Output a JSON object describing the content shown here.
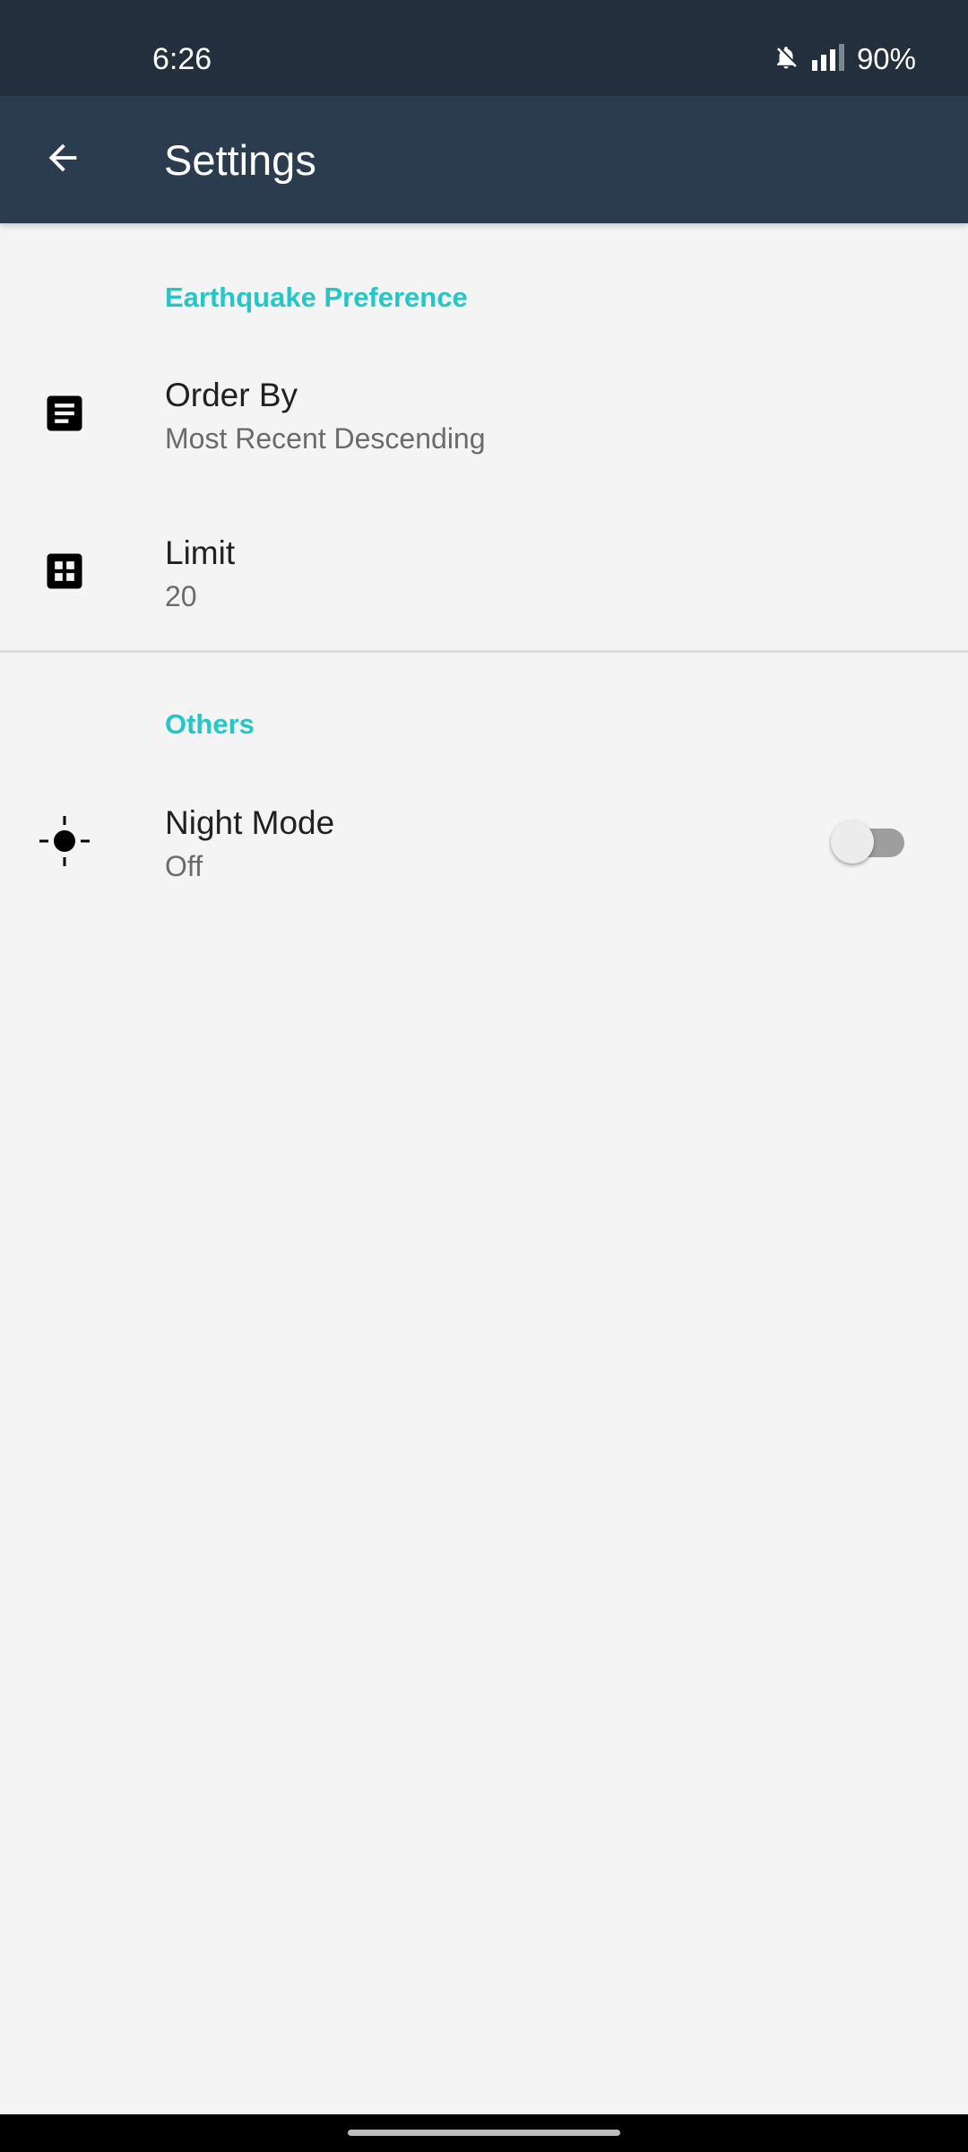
{
  "status_bar": {
    "time": "6:26",
    "battery": "90%",
    "icons": [
      "bell-off-icon",
      "signal-icon"
    ]
  },
  "toolbar": {
    "title": "Settings",
    "back_icon": "arrow-back-icon"
  },
  "sections": [
    {
      "category": "Earthquake Preference",
      "items": [
        {
          "title": "Order By",
          "summary": "Most Recent Descending",
          "icon": "notes-icon"
        },
        {
          "title": "Limit",
          "summary": "20",
          "icon": "grid-icon"
        }
      ]
    },
    {
      "category": "Others",
      "items": [
        {
          "title": "Night Mode",
          "summary": "Off",
          "icon": "brightness-icon",
          "switch_on": false
        }
      ]
    }
  ],
  "colors": {
    "status_bar": "#232f3c",
    "toolbar": "#2c3c4f",
    "accent": "#26c6c6",
    "background": "#f4f4f4"
  }
}
